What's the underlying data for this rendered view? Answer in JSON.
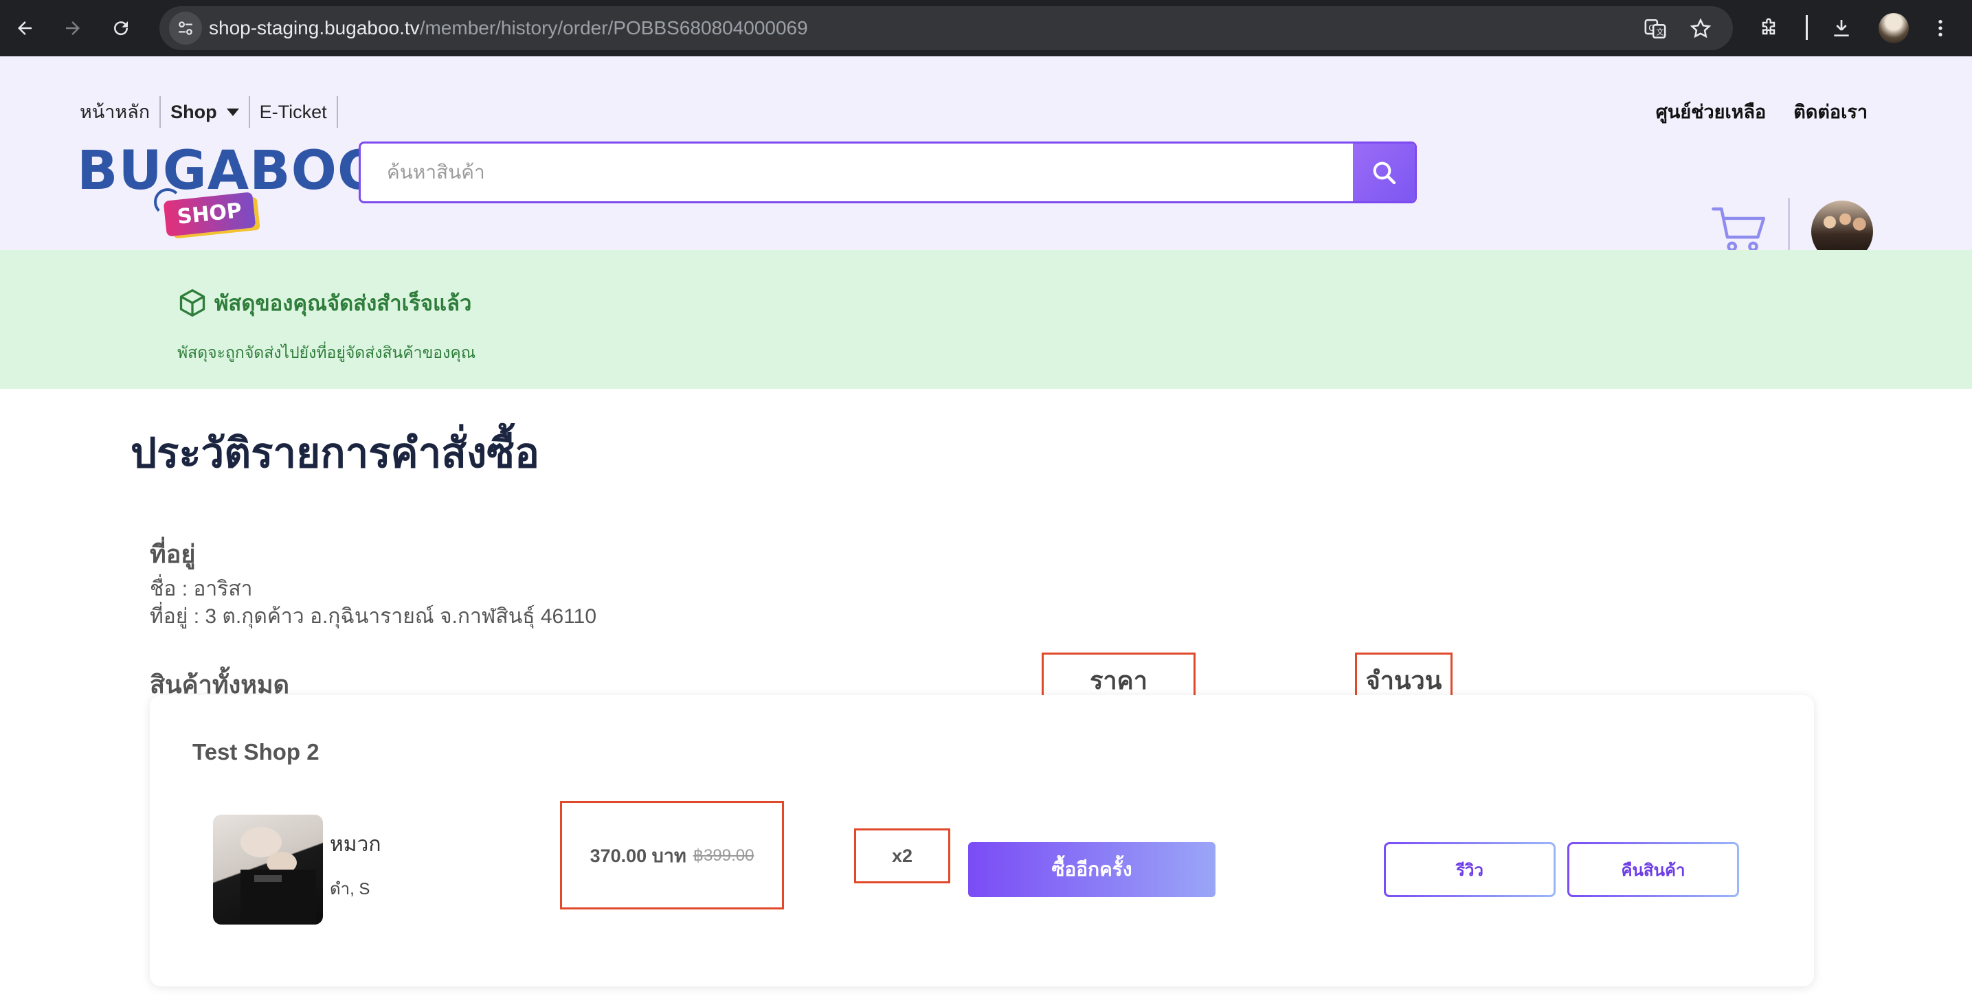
{
  "browser": {
    "url_host": "shop-staging.bugaboo.tv",
    "url_path": "/member/history/order/POBBS680804000069"
  },
  "header": {
    "nav": {
      "home": "หน้าหลัก",
      "shop": "Shop",
      "eticket": "E-Ticket"
    },
    "links": {
      "help": "ศูนย์ช่วยเหลือ",
      "contact": "ติดต่อเรา"
    },
    "logo": {
      "word": "BUGABOO",
      "tag": "SHOP"
    },
    "search": {
      "placeholder": "ค้นหาสินค้า",
      "value": ""
    }
  },
  "banner": {
    "title": "พัสดุของคุณจัดส่งสำเร็จแล้ว",
    "subtitle": "พัสดุจะถูกจัดส่งไปยังที่อยู่จัดส่งสินค้าของคุณ"
  },
  "page": {
    "title": "ประวัติรายการคำสั่งซื้อ"
  },
  "address": {
    "heading": "ที่อยู่",
    "name_line": "ชื่อ : อาริสา",
    "address_line": "ที่อยู่ : 3 ต.กุดค้าว อ.กุฉินารายณ์ จ.กาฬสินธุ์ 46110"
  },
  "products": {
    "heading": "สินค้าทั้งหมด",
    "col_price": "ราคา",
    "col_qty": "จำนวน",
    "shop": {
      "name": "Test Shop 2",
      "items": [
        {
          "name": "หมวก",
          "variant": "ดำ, S",
          "price": "370.00 บาท",
          "original_price": "฿399.00",
          "qty": "x2",
          "buy_again": "ซื้ออีกครั้ง",
          "review": "รีวิว",
          "return": "คืนสินค้า"
        }
      ]
    }
  },
  "colors": {
    "accent": "#7d4bf0",
    "brand_blue": "#2f56a6",
    "success_green": "#2f7d3a",
    "banner_bg": "#dcf5e1",
    "header_bg": "#f3f0fd",
    "highlight_red": "#e04a2a"
  }
}
